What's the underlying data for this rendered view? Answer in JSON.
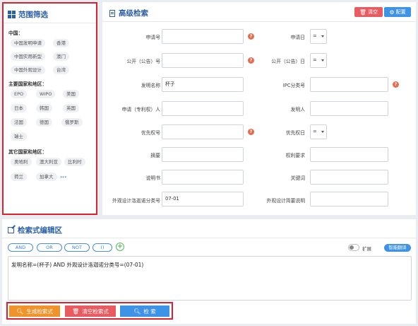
{
  "filter": {
    "title": "范围筛选",
    "groups": [
      {
        "label": "中国：",
        "tags": [
          "中国发明申请",
          "香港",
          "中国实用新型",
          "澳门",
          "中国外观设计",
          "台湾"
        ]
      },
      {
        "label": "主要国家和地区：",
        "tags": [
          "EPO",
          "WIPO",
          "美国",
          "日本",
          "韩国",
          "英国",
          "法国",
          "德国",
          "俄罗斯",
          "瑞士"
        ]
      },
      {
        "label": "其它国家和地区：",
        "tags": [
          "奥地利",
          "澳大利亚",
          "比利时",
          "荷兰",
          "加拿大"
        ],
        "more": "..."
      }
    ]
  },
  "adv": {
    "title": "高级检索",
    "clear_label": "清空",
    "config_label": "配置",
    "fields": {
      "app_no": "申请号",
      "app_date": "申请日",
      "pub_no": "公开（公告）号",
      "pub_date": "公开（公告）日",
      "title": "发明名称",
      "title_value": "杯子",
      "ipc": "IPC分类号",
      "applicant": "申请（专利权）人",
      "inventor": "发明人",
      "priority_no": "优先权号",
      "priority_date": "优先权日",
      "abstract": "摘要",
      "claims": "权利要求",
      "description": "说明书",
      "keywords": "关键词",
      "locarno": "外观设计洛迦诺分类号",
      "locarno_value": "07-01",
      "design_brief": "外观设计简要说明"
    },
    "operator": "="
  },
  "editor": {
    "title": "检索式编辑区",
    "ops": [
      "AND",
      "OR",
      "NOT",
      "()"
    ],
    "expand_label": "扩展",
    "translate_label": "智能翻译",
    "query": "发明名称=(杯子) AND 外观设计洛迦诺分类号=(07-01)",
    "generate_label": "生成检索式",
    "clear_label": "清空检索式",
    "search_label": "检 索"
  },
  "colors": {
    "accent": "#2b5fa6",
    "danger": "#e85c61",
    "primary": "#3f93e6",
    "orange": "#f0932b",
    "highlight_frame": "#e0202c"
  },
  "icons": [
    "grid-icon",
    "doc-icon",
    "trash-icon",
    "gear-icon",
    "question-icon",
    "pen-icon",
    "plus-icon",
    "search-icon"
  ]
}
